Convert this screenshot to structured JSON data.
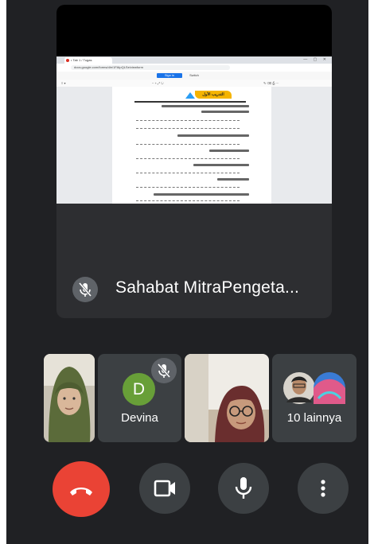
{
  "presenter": {
    "name": "Sahabat MitraPengeta...",
    "mic_icon": "mic-off-icon"
  },
  "shared_screen": {
    "tab_title": "• Tab 1 / Tugas",
    "url": "docs.google.com/forms/d/e/1FAIpQLSe/viewform",
    "primary_button": "Sign in",
    "secondary_button": "Switch",
    "doc_heading": "التدريب الأول"
  },
  "participants": [
    {
      "name": "",
      "type": "video"
    },
    {
      "name": "Devina",
      "initial": "D",
      "avatar_color": "#689f38",
      "muted": true
    },
    {
      "name": "",
      "type": "video"
    },
    {
      "name": "10 lainnya",
      "type": "group"
    }
  ],
  "controls": {
    "end_call": "end-call-icon",
    "camera": "video-camera-icon",
    "microphone": "mic-icon",
    "more": "more-vert-icon"
  },
  "colors": {
    "background": "#202124",
    "tile": "#3c4043",
    "end_call": "#ea4335",
    "accent": "#1a73e8"
  }
}
